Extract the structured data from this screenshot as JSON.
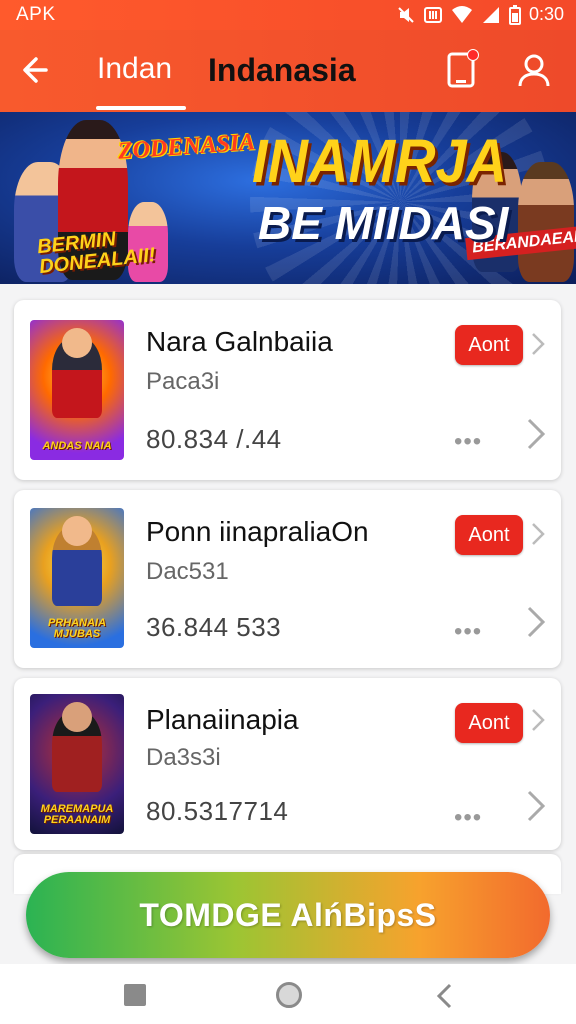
{
  "status_bar": {
    "carrier": "APK",
    "time": "0:30"
  },
  "header": {
    "tabs": [
      {
        "label": "Indan",
        "active": true
      },
      {
        "label": "Indanasia",
        "active": false
      }
    ],
    "icons": [
      "back-arrow-icon",
      "phone-icon",
      "user-icon"
    ]
  },
  "banner": {
    "left_tag": "ZODENASIA",
    "corner_text": "BERMIN DONEALAII!",
    "title_line1": "INAMRJA",
    "title_line2": "BE MIIDASI",
    "right_tag": "BERANDAEAI"
  },
  "apps": [
    {
      "name": "Nara Galnbaiia",
      "subtitle": "Paca3i",
      "number": "80.834 /.44",
      "button": "Aont",
      "thumb_title": "ANDAS NAIA",
      "thumb_colors": [
        "#8a2be2",
        "#ff6a00"
      ]
    },
    {
      "name": "Ponn iinapraliaOn",
      "subtitle": "Dac531",
      "number": "36.844 533",
      "button": "Aont",
      "thumb_title": "PRHANAIA MJUBAS",
      "thumb_colors": [
        "#e8a020",
        "#2a6fe0"
      ]
    },
    {
      "name": "Planaiinapia",
      "subtitle": "Da3s3i",
      "number": "80.5317714",
      "button": "Aont",
      "thumb_title": "MAREMAPUA PERAANAIM",
      "thumb_colors": [
        "#3b1f7a",
        "#c03030"
      ]
    }
  ],
  "cta": {
    "label": "TOMDGE AlńBipsS"
  },
  "colors": {
    "brand": "#f04e2a",
    "accent_red": "#e8281f"
  }
}
